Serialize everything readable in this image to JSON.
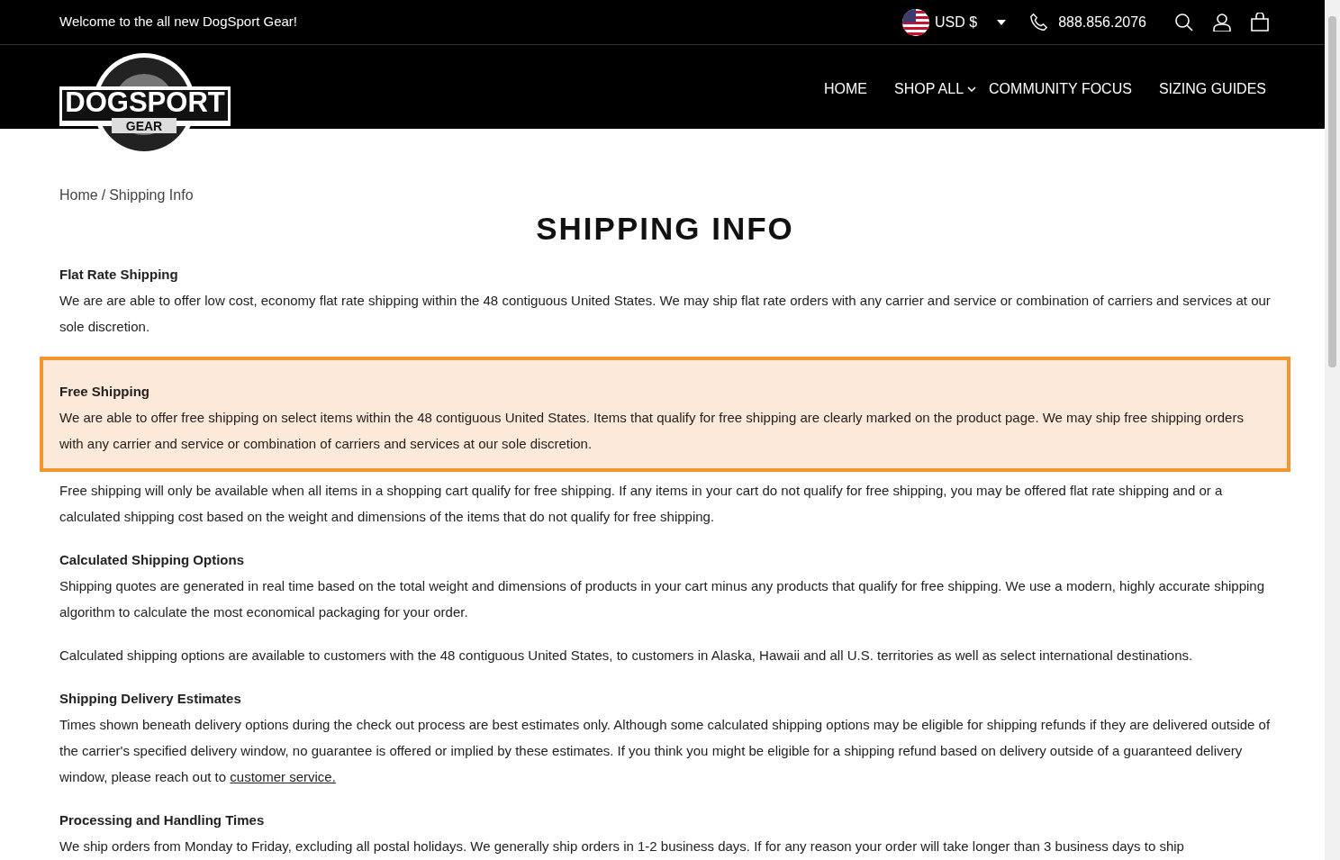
{
  "top_bar": {
    "welcome": "Welcome to the all new DogSport Gear!",
    "currency": "USD $",
    "phone": "888.856.2076"
  },
  "logo": {
    "word": "DOGSPORT",
    "sub": "GEAR"
  },
  "nav": [
    {
      "label": "HOME",
      "has_dropdown": false
    },
    {
      "label": "SHOP ALL",
      "has_dropdown": true
    },
    {
      "label": "COMMUNITY FOCUS",
      "has_dropdown": false
    },
    {
      "label": "SIZING GUIDES",
      "has_dropdown": false
    }
  ],
  "breadcrumb": {
    "items": [
      "Home",
      "Shipping Info"
    ],
    "separator": "/"
  },
  "title": "SHIPPING INFO",
  "sections": [
    {
      "heading": "Flat Rate Shipping",
      "highlighted": false,
      "paragraphs": [
        {
          "text": "We are are able to offer low cost, economy flat rate shipping within the 48 contiguous United States. We may ship flat rate orders with any carrier and service or combination of carriers and services at our sole discretion."
        }
      ]
    },
    {
      "heading": "Free Shipping",
      "highlighted": true,
      "paragraphs": [
        {
          "text": "We are able to offer free shipping on select items within the 48 contiguous United States. Items that qualify for free shipping are clearly marked on the product page. We may ship free shipping orders with any carrier and service or combination of carriers and services at our sole discretion."
        }
      ]
    },
    {
      "highlighted": false,
      "paragraphs": [
        {
          "text": "Free shipping will only be available when all items in a shopping cart qualify for free shipping. If any items in your cart do not qualify for free shipping, you may be offered flat rate shipping and or a calculated shipping cost based on the weight and dimensions of the items that do not qualify for free shipping."
        }
      ]
    },
    {
      "heading": "Calculated Shipping Options",
      "highlighted": false,
      "paragraphs": [
        {
          "text": "Shipping quotes are generated in real time based on the total weight and dimensions of products in your cart minus any products that qualify for free shipping.  We use a modern, highly accurate shipping algorithm to calculate the most economical packaging for your order."
        },
        {
          "text": "Calculated shipping options are available to customers with the 48 contiguous United States, to customers in Alaska, Hawaii and all U.S. territories as well as select international destinations."
        }
      ]
    },
    {
      "heading": "Shipping Delivery Estimates",
      "highlighted": false,
      "paragraphs": [
        {
          "text": "Times shown beneath delivery options during the check out process are best estimates only.  Although some calculated shipping options may be eligible for shipping refunds if they are delivered outside of the carrier's specified delivery window, no guarantee is offered or implied by these estimates. If you think you might be eligible for a shipping refund based on delivery outside of a guaranteed delivery window, please reach out to",
          "link": "customer service."
        }
      ]
    },
    {
      "heading": "Processing and Handling Times",
      "highlighted": false,
      "paragraphs": [
        {
          "text": "We ship orders from Monday to Friday, excluding all postal holidays.  We generally ship orders in 1-2 business days.  If for any reason your order will take longer than 3 business days to ship"
        }
      ]
    }
  ]
}
